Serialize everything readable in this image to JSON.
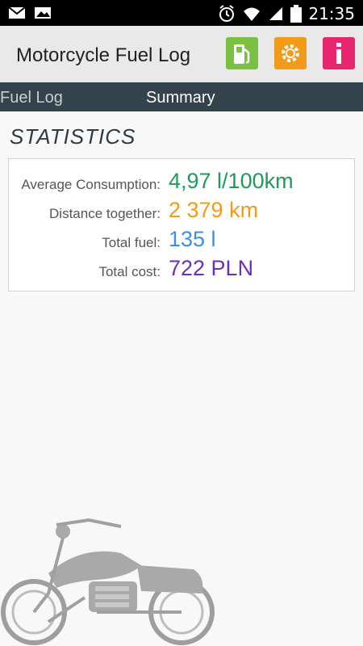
{
  "status_bar": {
    "time": "21:35",
    "left_icons": [
      "mail-icon",
      "image-icon"
    ],
    "right_icons": [
      "alarm-icon",
      "wifi-icon",
      "signal-icon",
      "battery-icon"
    ]
  },
  "app_bar": {
    "title": "Motorcycle Fuel Log",
    "actions": [
      {
        "name": "fuel-pump-icon",
        "color": "#7ac143"
      },
      {
        "name": "settings-gear-icon",
        "color": "#f29a19"
      },
      {
        "name": "info-icon",
        "color": "#e8266f"
      }
    ]
  },
  "tabs": [
    {
      "label": "Fuel Log",
      "active": false
    },
    {
      "label": "Summary",
      "active": true
    }
  ],
  "statistics": {
    "title": "STATISTICS",
    "rows": [
      {
        "label": "Average Consumption:",
        "value": "4,97 l/100km",
        "color": "#1f9a58"
      },
      {
        "label": "Distance together:",
        "value": "2 379 km",
        "color": "#f29a19"
      },
      {
        "label": "Total fuel:",
        "value": "135 l",
        "color": "#3c8fe6"
      },
      {
        "label": "Total cost:",
        "value": "722 PLN",
        "color": "#6a31b8"
      }
    ]
  },
  "decoration": {
    "image": "motorcycle-illustration"
  }
}
